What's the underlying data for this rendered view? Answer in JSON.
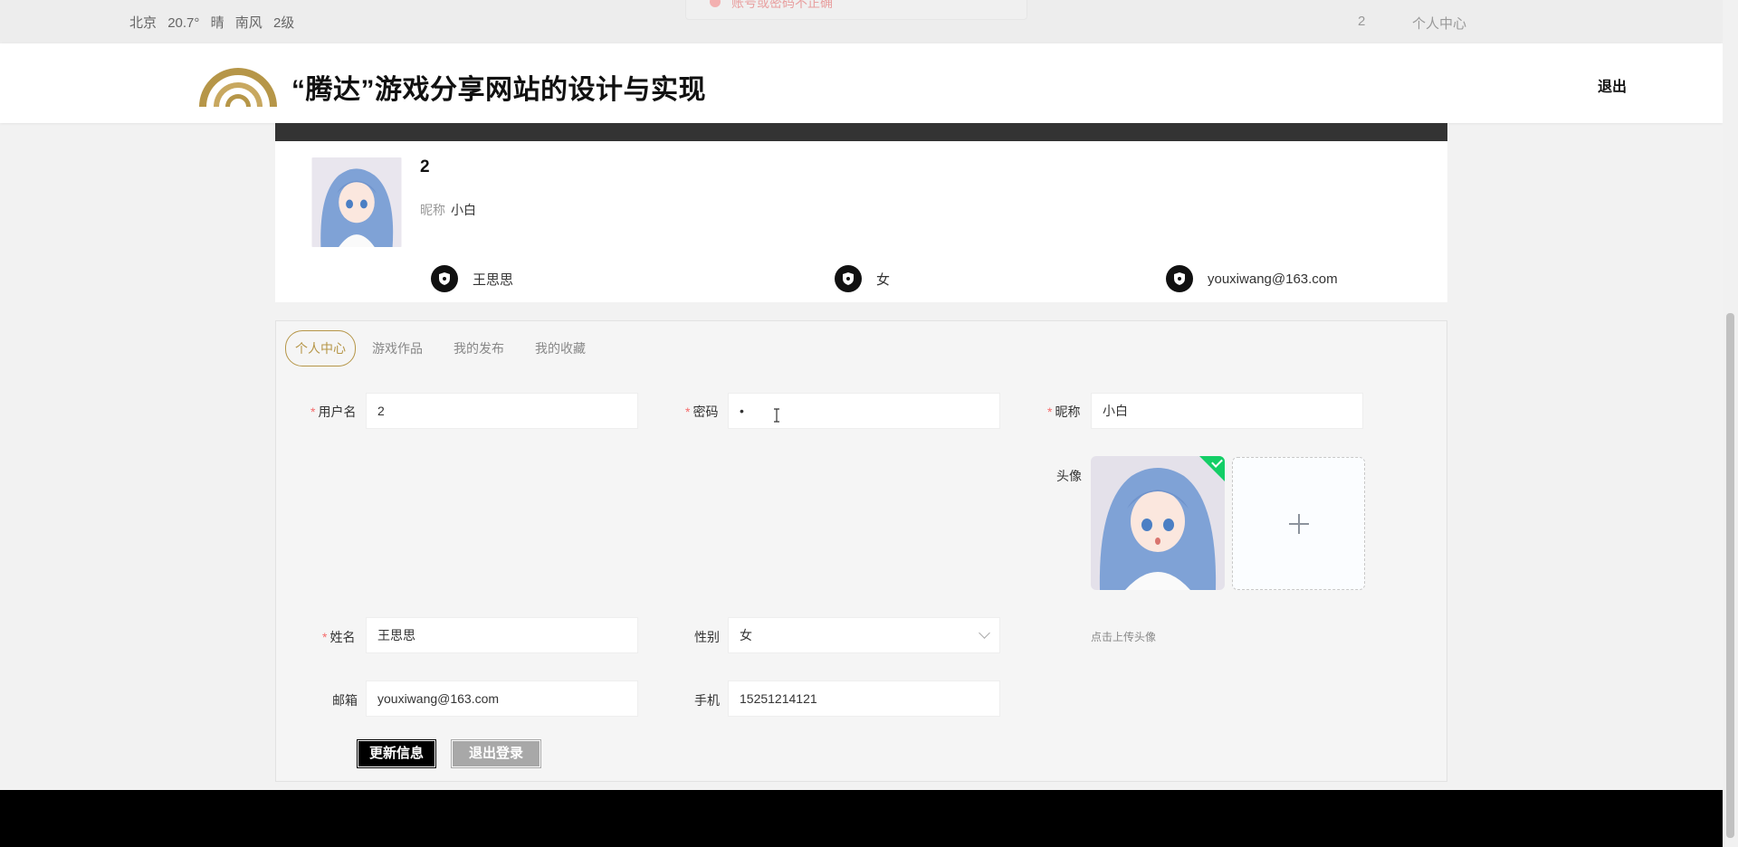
{
  "topbar": {
    "weather": [
      "北京",
      "20.7°",
      "晴",
      "南风",
      "2级"
    ],
    "toast_text": "账号或密码不正确",
    "user": "2",
    "center_link": "个人中心"
  },
  "header": {
    "title": "“腾达”游戏分享网站的设计与实现",
    "logout": "退出",
    "accent": "#b69648"
  },
  "profile": {
    "username": "2",
    "nick_label": "昵称",
    "nickname": "小白",
    "name": "王思思",
    "gender": "女",
    "email": "youxiwang@163.com"
  },
  "tabs": [
    {
      "label": "个人中心",
      "active": true
    },
    {
      "label": "游戏作品",
      "active": false
    },
    {
      "label": "我的发布",
      "active": false
    },
    {
      "label": "我的收藏",
      "active": false
    }
  ],
  "form": {
    "username_label": "用户名",
    "username_value": "2",
    "password_label": "密码",
    "password_value": "•",
    "nickname_label": "昵称",
    "nickname_value": "小白",
    "avatar_label": "头像",
    "upload_tip": "点击上传头像",
    "name_label": "姓名",
    "name_value": "王思思",
    "gender_label": "性别",
    "gender_value": "女",
    "email_label": "邮箱",
    "email_value": "youxiwang@163.com",
    "phone_label": "手机",
    "phone_value": "15251214121"
  },
  "buttons": {
    "update": "更新信息",
    "logout": "退出登录"
  }
}
